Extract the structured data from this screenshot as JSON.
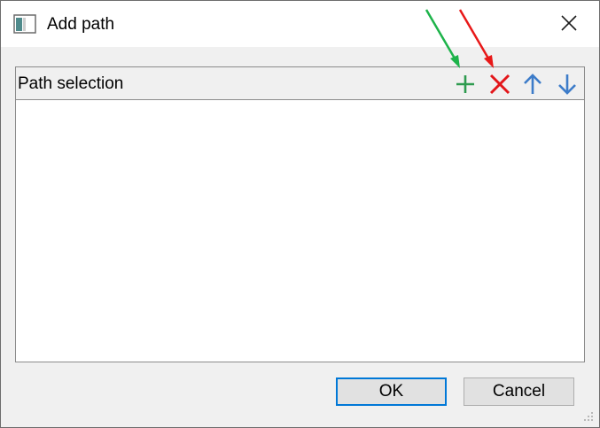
{
  "window": {
    "title": "Add path",
    "icon": "app-window-icon",
    "close_icon": "close-icon"
  },
  "panel": {
    "title": "Path selection",
    "tools": [
      {
        "name": "add-path",
        "icon": "plus-icon",
        "color": "#2e9b4f"
      },
      {
        "name": "remove-path",
        "icon": "x-icon",
        "color": "#e3161a"
      },
      {
        "name": "move-up",
        "icon": "arrow-up-icon",
        "color": "#3d7cc9"
      },
      {
        "name": "move-down",
        "icon": "arrow-down-icon",
        "color": "#3d7cc9"
      }
    ],
    "items": []
  },
  "buttons": {
    "ok_label": "OK",
    "cancel_label": "Cancel"
  },
  "annotations": {
    "arrow_colors": [
      "#1db34a",
      "#e81818"
    ]
  },
  "colors": {
    "accent": "#0078d7"
  }
}
